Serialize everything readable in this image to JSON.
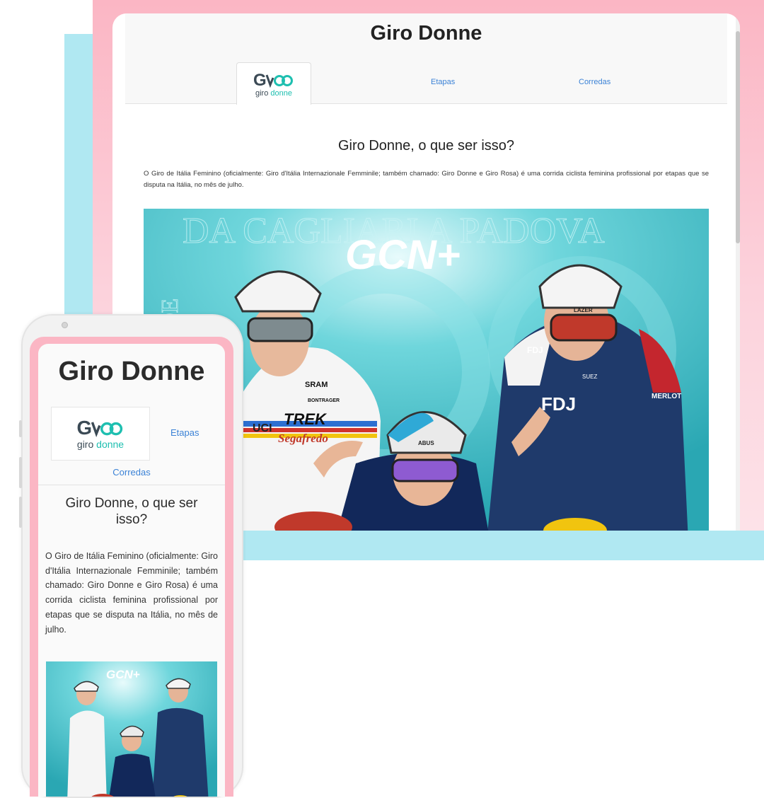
{
  "site": {
    "title": "Giro Donne",
    "logo": {
      "mark": "Giro",
      "word_a": "giro",
      "word_b": "donne",
      "accent": "#1ebfb0"
    },
    "nav": [
      {
        "label": "Etapas"
      },
      {
        "label": "Corredas"
      }
    ],
    "section_title": "Giro Donne, o que ser isso?",
    "paragraph": "O Giro de Itália Feminino (oficialmente: Giro d'Itália Internazionale Femminile; também chamado: Giro Donne e Giro Rosa) é uma corrida ciclista feminina profissional por etapas que se disputa na Itália, no mês de julho.",
    "photo": {
      "brand": "GCN+",
      "bg_text_top": "DA CAGLIARI A PADOVA",
      "bg_text_side": "VERDE",
      "jersey_text": [
        "TREK",
        "Segafredo",
        "SRAM",
        "UCI",
        "BONTRAGER",
        "FDJ",
        "SUEZ",
        "LAZER",
        "ABUS",
        "MERLOT"
      ]
    }
  },
  "colors": {
    "pink": "#fbb6c4",
    "cyan": "#b0e8f2",
    "link": "#3b82d6",
    "teal": "#1ebfb0"
  }
}
